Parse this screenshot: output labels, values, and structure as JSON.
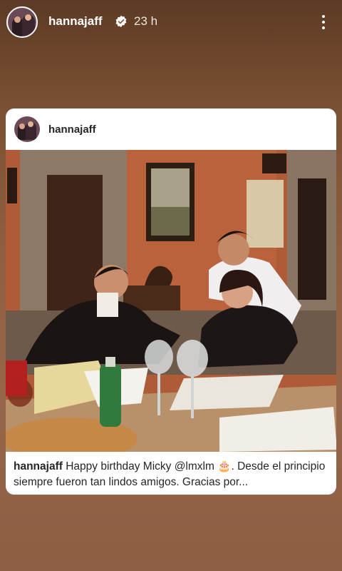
{
  "story": {
    "username": "hannajaff",
    "timestamp": "23 h",
    "verified": true
  },
  "post": {
    "username": "hannajaff",
    "caption_user": "hannajaff",
    "caption_text": "Happy birthday Micky @lmxlm 🎂. Desde el principio siempre fueron tan lindos amigos. Gracias por..."
  },
  "icons": {
    "verified": "verified-badge-icon",
    "more": "more-options-icon"
  },
  "colors": {
    "background": "#8f603f",
    "card": "#ffffff",
    "text": "#262626"
  }
}
